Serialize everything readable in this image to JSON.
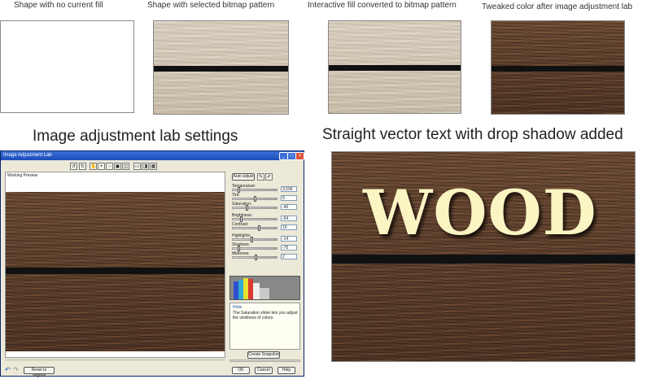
{
  "captions": {
    "no_fill": "Shape with no current fill",
    "bitmap": "Shape with selected bitmap pattern",
    "interactive": "Interactive fill converted to bitmap pattern",
    "tweaked": "Tweaked color after image adjustment lab",
    "lab_settings": "Image adjustment lab settings",
    "vector_text": "Straight vector text with drop shadow added"
  },
  "wood_word": "WOOD",
  "dialog": {
    "title": "Image Adjustment Lab",
    "preview_label": "Working Preview",
    "auto_adjust": "Auto adjust",
    "controls": [
      {
        "label": "Temperature:",
        "value": "3,595",
        "level": 0.12
      },
      {
        "label": "Tint:",
        "value": "0",
        "level": 0.5
      },
      {
        "label": "Saturation:",
        "value": "-40",
        "level": 0.3
      },
      {
        "label": "Brightness:",
        "value": "-64",
        "level": 0.18
      },
      {
        "label": "Contrast:",
        "value": "19",
        "level": 0.6
      },
      {
        "label": "Highlights:",
        "value": "-14",
        "level": 0.42
      },
      {
        "label": "Shadows:",
        "value": "-75",
        "level": 0.12
      },
      {
        "label": "Midtones:",
        "value": "2",
        "level": 0.52
      }
    ],
    "hints_title": "Hints",
    "hints_text": "The Saturation slider lets you adjust the vividness of colors.",
    "create_snapshot": "Create Snapshot",
    "reset": "Reset to original",
    "ok": "OK",
    "cancel": "Cancel",
    "help": "Help"
  }
}
